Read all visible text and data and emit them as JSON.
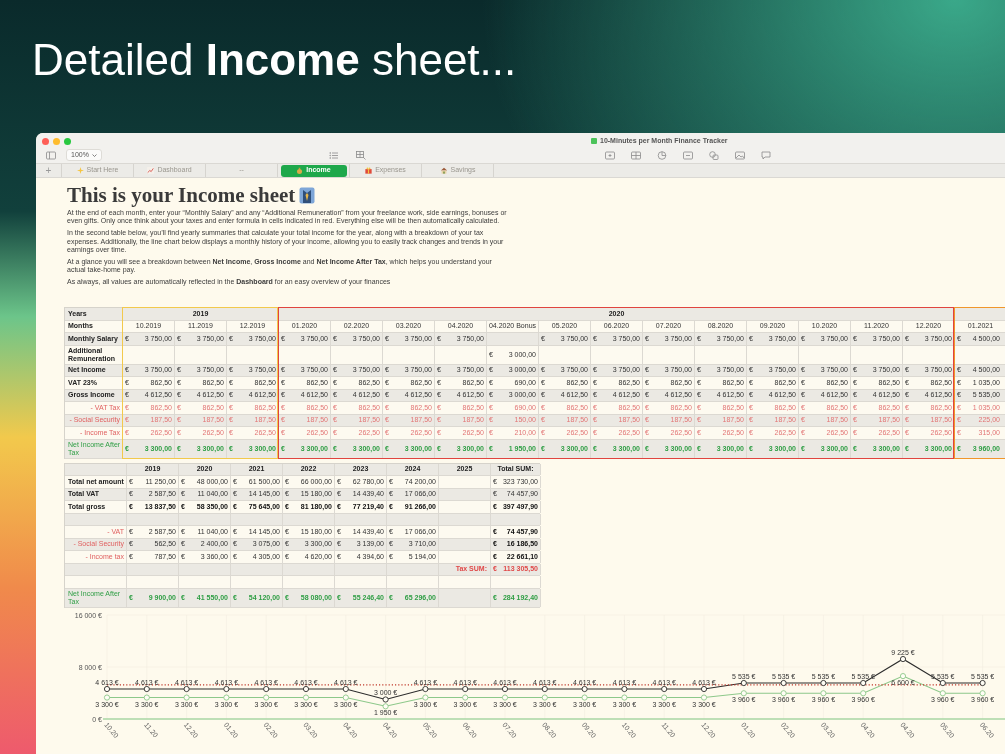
{
  "headline": "Detailed **Income** sheet...",
  "window": {
    "title": "10-Minutes per Month Finance Tracker",
    "zoom": "100%",
    "add_sheet": "+"
  },
  "tabs": [
    {
      "label": "Start Here",
      "selected": false
    },
    {
      "label": "Dashboard",
      "selected": false
    },
    {
      "label": "--",
      "selected": false
    },
    {
      "label": "Income",
      "selected": true
    },
    {
      "label": "Expenses",
      "selected": false
    },
    {
      "label": "Savings",
      "selected": false
    }
  ],
  "sheet": {
    "title": "This is your Income sheet",
    "paragraphs": [
      "At the end of each month, enter your “Monthly Salary” and any “Additional Remuneration” from your freelance work, side earnings, bonuses or even gifts. Only once think about your taxes and enter formula in cells indicated in red. Everything else will be then automatically calculated.",
      "In the second table below, you’ll find yearly summaries that calculate your total income for the year, along with a breakdown of your tax expenses. Additionally, the line chart below displays a monthly history of your income, allowing you to easily track changes and trends in your earnings over time.",
      "At a glance you will see a breakdown between **Net Income**, **Gross Income** and **Net Income After Tax**, which helps you understand your actual take-home pay.",
      "As always, all values are automatically reflected in the **Dashboard** for an easy overview of your finances"
    ]
  },
  "income_table": {
    "currency": "€",
    "years_label": "Years",
    "months_label": "Months",
    "rows": [
      {
        "label": "Monthly Salary",
        "kind": "plain"
      },
      {
        "label": "Additional Remuneration",
        "kind": "plain"
      },
      {
        "label": "Net Income",
        "kind": "plain"
      },
      {
        "label": "VAT 23%",
        "kind": "plain"
      },
      {
        "label": "Gross Income",
        "kind": "plain"
      },
      {
        "label": "- VAT Tax",
        "kind": "tax"
      },
      {
        "label": "- Social Security",
        "kind": "tax"
      },
      {
        "label": "- Income Tax",
        "kind": "tax"
      },
      {
        "label": "Net Income After Tax",
        "kind": "result"
      }
    ],
    "year_groups": [
      {
        "year": "2019",
        "color": "#f2c94c",
        "months": [
          {
            "month": "10.2019",
            "salary": "3 750,00",
            "net": "3 750,00",
            "vat": "862,50",
            "gross": "4 612,50",
            "vat_tax": "862,50",
            "social_security": "187,50",
            "income_tax": "262,50",
            "after_tax": "3 300,00"
          },
          {
            "month": "11.2019",
            "salary": "3 750,00",
            "net": "3 750,00",
            "vat": "862,50",
            "gross": "4 612,50",
            "vat_tax": "862,50",
            "social_security": "187,50",
            "income_tax": "262,50",
            "after_tax": "3 300,00"
          },
          {
            "month": "12.2019",
            "salary": "3 750,00",
            "net": "3 750,00",
            "vat": "862,50",
            "gross": "4 612,50",
            "vat_tax": "862,50",
            "social_security": "187,50",
            "income_tax": "262,50",
            "after_tax": "3 300,00"
          }
        ]
      },
      {
        "year": "2020",
        "color": "#e0443f",
        "months": [
          {
            "month": "01.2020",
            "salary": "3 750,00",
            "net": "3 750,00",
            "vat": "862,50",
            "gross": "4 612,50",
            "vat_tax": "862,50",
            "social_security": "187,50",
            "income_tax": "262,50",
            "after_tax": "3 300,00"
          },
          {
            "month": "02.2020",
            "salary": "3 750,00",
            "net": "3 750,00",
            "vat": "862,50",
            "gross": "4 612,50",
            "vat_tax": "862,50",
            "social_security": "187,50",
            "income_tax": "262,50",
            "after_tax": "3 300,00"
          },
          {
            "month": "03.2020",
            "salary": "3 750,00",
            "net": "3 750,00",
            "vat": "862,50",
            "gross": "4 612,50",
            "vat_tax": "862,50",
            "social_security": "187,50",
            "income_tax": "262,50",
            "after_tax": "3 300,00"
          },
          {
            "month": "04.2020",
            "salary": "3 750,00",
            "net": "3 750,00",
            "vat": "862,50",
            "gross": "4 612,50",
            "vat_tax": "862,50",
            "social_security": "187,50",
            "income_tax": "262,50",
            "after_tax": "3 300,00"
          },
          {
            "month": "04.2020 Bonus",
            "additional": "3 000,00",
            "net": "3 000,00",
            "vat": "690,00",
            "gross": "3 000,00",
            "vat_tax": "690,00",
            "social_security": "150,00",
            "income_tax": "210,00",
            "after_tax": "1 950,00"
          },
          {
            "month": "05.2020",
            "salary": "3 750,00",
            "net": "3 750,00",
            "vat": "862,50",
            "gross": "4 612,50",
            "vat_tax": "862,50",
            "social_security": "187,50",
            "income_tax": "262,50",
            "after_tax": "3 300,00"
          },
          {
            "month": "06.2020",
            "salary": "3 750,00",
            "net": "3 750,00",
            "vat": "862,50",
            "gross": "4 612,50",
            "vat_tax": "862,50",
            "social_security": "187,50",
            "income_tax": "262,50",
            "after_tax": "3 300,00"
          },
          {
            "month": "07.2020",
            "salary": "3 750,00",
            "net": "3 750,00",
            "vat": "862,50",
            "gross": "4 612,50",
            "vat_tax": "862,50",
            "social_security": "187,50",
            "income_tax": "262,50",
            "after_tax": "3 300,00"
          },
          {
            "month": "08.2020",
            "salary": "3 750,00",
            "net": "3 750,00",
            "vat": "862,50",
            "gross": "4 612,50",
            "vat_tax": "862,50",
            "social_security": "187,50",
            "income_tax": "262,50",
            "after_tax": "3 300,00"
          },
          {
            "month": "09.2020",
            "salary": "3 750,00",
            "net": "3 750,00",
            "vat": "862,50",
            "gross": "4 612,50",
            "vat_tax": "862,50",
            "social_security": "187,50",
            "income_tax": "262,50",
            "after_tax": "3 300,00"
          },
          {
            "month": "10.2020",
            "salary": "3 750,00",
            "net": "3 750,00",
            "vat": "862,50",
            "gross": "4 612,50",
            "vat_tax": "862,50",
            "social_security": "187,50",
            "income_tax": "262,50",
            "after_tax": "3 300,00"
          },
          {
            "month": "11.2020",
            "salary": "3 750,00",
            "net": "3 750,00",
            "vat": "862,50",
            "gross": "4 612,50",
            "vat_tax": "862,50",
            "social_security": "187,50",
            "income_tax": "262,50",
            "after_tax": "3 300,00"
          },
          {
            "month": "12.2020",
            "salary": "3 750,00",
            "net": "3 750,00",
            "vat": "862,50",
            "gross": "4 612,50",
            "vat_tax": "862,50",
            "social_security": "187,50",
            "income_tax": "262,50",
            "after_tax": "3 300,00"
          }
        ]
      },
      {
        "color": "#f0962b",
        "months": [
          {
            "month": "01.2021",
            "salary": "4 500,00",
            "net": "4 500,00",
            "vat": "1 035,00",
            "gross": "5 535,00",
            "vat_tax": "1 035,00",
            "social_security": "225,00",
            "income_tax": "315,00",
            "after_tax": "3 960,00"
          }
        ]
      }
    ]
  },
  "summary_table": {
    "currency": "€",
    "rows": [
      {
        "label": "Total net amount",
        "kind": "plain"
      },
      {
        "label": "Total VAT",
        "kind": "plain"
      },
      {
        "label": "Total gross",
        "kind": "total"
      },
      {
        "kind": "blank"
      },
      {
        "label": "- VAT",
        "kind": "tax"
      },
      {
        "label": "- Social Security",
        "kind": "tax"
      },
      {
        "label": "- Income tax",
        "kind": "tax"
      },
      {
        "kind": "tax_sum"
      },
      {
        "kind": "blank"
      },
      {
        "label": "Net Income After Tax",
        "kind": "result"
      }
    ],
    "columns": [
      {
        "year": "2019",
        "net": "11 250,00",
        "vat": "2 587,50",
        "gross": "13 837,50",
        "vat_tax": "2 587,50",
        "social_security": "562,50",
        "income_tax": "787,50",
        "after_tax": "9 900,00"
      },
      {
        "year": "2020",
        "net": "48 000,00",
        "vat": "11 040,00",
        "gross": "58 350,00",
        "vat_tax": "11 040,00",
        "social_security": "2 400,00",
        "income_tax": "3 360,00",
        "after_tax": "41 550,00"
      },
      {
        "year": "2021",
        "net": "61 500,00",
        "vat": "14 145,00",
        "gross": "75 645,00",
        "vat_tax": "14 145,00",
        "social_security": "3 075,00",
        "income_tax": "4 305,00",
        "after_tax": "54 120,00"
      },
      {
        "year": "2022",
        "net": "66 000,00",
        "vat": "15 180,00",
        "gross": "81 180,00",
        "vat_tax": "15 180,00",
        "social_security": "3 300,00",
        "income_tax": "4 620,00",
        "after_tax": "58 080,00"
      },
      {
        "year": "2023",
        "net": "62 780,00",
        "vat": "14 439,40",
        "gross": "77 219,40",
        "vat_tax": "14 439,40",
        "social_security": "3 139,00",
        "income_tax": "4 394,60",
        "after_tax": "55 246,40"
      },
      {
        "year": "2024",
        "net": "74 200,00",
        "vat": "17 066,00",
        "gross": "91 266,00",
        "vat_tax": "17 066,00",
        "social_security": "3 710,00",
        "income_tax": "5 194,00",
        "after_tax": "65 296,00"
      },
      {
        "year": "2025",
        "tax_sum_label": "Tax SUM:"
      },
      {
        "year": "Total SUM:",
        "net": "323 730,00",
        "vat": "74 457,90",
        "gross": "397 497,90",
        "vat_tax": "74 457,90",
        "social_security": "16 186,50",
        "income_tax": "22 661,10",
        "tax_sum": "113 305,50",
        "after_tax": "284 192,40"
      }
    ]
  },
  "chart": {
    "chart_data": {
      "type": "line",
      "grid": true,
      "categories": [
        "10.20",
        "11.20",
        "12.20",
        "01.20",
        "02.20",
        "03.20",
        "04.20",
        "04.20",
        "05.20",
        "06.20",
        "07.20",
        "08.20",
        "09.20",
        "10.20",
        "11.20",
        "12.20",
        "01.20",
        "02.20",
        "03.20",
        "04.20",
        "04.20",
        "05.20",
        "06.20"
      ],
      "series": [
        {
          "color": "#2b2b2b",
          "marker": "circle",
          "values": [
            4613,
            4613,
            4613,
            4613,
            4613,
            4613,
            4613,
            3000,
            4613,
            4613,
            4613,
            4613,
            4613,
            4613,
            4613,
            4613,
            5535,
            5535,
            5535,
            5535,
            9225,
            5535,
            5535
          ],
          "value_labels": [
            "4 613 €",
            "4 613 €",
            "4 613 €",
            "4 613 €",
            "4 613 €",
            "4 613 €",
            "4 613 €",
            "3 000 €",
            "4 613 €",
            "4 613 €",
            "4 613 €",
            "4 613 €",
            "4 613 €",
            "4 613 €",
            "4 613 €",
            "4 613 €",
            "5 535 €",
            "5 535 €",
            "5 535 €",
            "5 535 €",
            "9 225 €",
            "5 535 €",
            "5 535 €"
          ]
        },
        {
          "color": "#8dc88a",
          "marker": "circle",
          "values": [
            3300,
            3300,
            3300,
            3300,
            3300,
            3300,
            3300,
            1950,
            3300,
            3300,
            3300,
            3300,
            3300,
            3300,
            3300,
            3300,
            3960,
            3960,
            3960,
            3960,
            6600,
            3960,
            3960
          ],
          "value_labels": [
            "3 300 €",
            "3 300 €",
            "3 300 €",
            "3 300 €",
            "3 300 €",
            "3 300 €",
            "3 300 €",
            "1 950 €",
            "3 300 €",
            "3 300 €",
            "3 300 €",
            "3 300 €",
            "3 300 €",
            "3 300 €",
            "3 300 €",
            "3 300 €",
            "3 960 €",
            "3 960 €",
            "3 960 €",
            "3 960 €",
            "6 600 €",
            "3 960 €",
            "3 960 €"
          ]
        },
        {
          "color": "#c0392b",
          "line_style": "dotted",
          "values": [
            5250,
            5250,
            5250,
            5250,
            5250,
            5250,
            5250,
            5250,
            5250,
            5250,
            5250,
            5250,
            5250,
            5250,
            5250,
            5250,
            5250,
            5250,
            5250,
            5250,
            5250,
            5250,
            5250
          ]
        }
      ],
      "ylim": [
        0,
        16000
      ],
      "yticks": [
        {
          "value": 0,
          "label": "0 €"
        },
        {
          "value": 8000,
          "label": "8 000 €"
        },
        {
          "value": 16000,
          "label": "16 000 €"
        }
      ]
    }
  }
}
